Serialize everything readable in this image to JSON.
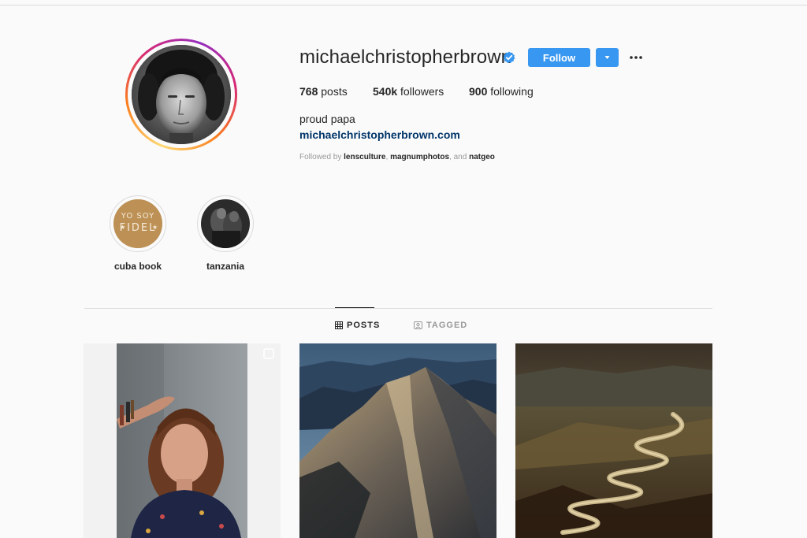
{
  "profile": {
    "username": "michaelchristopherbrown",
    "follow_label": "Follow",
    "stats": {
      "posts_count": "768",
      "posts_label": "posts",
      "followers_count": "540k",
      "followers_label": "followers",
      "following_count": "900",
      "following_label": "following"
    },
    "bio": "proud papa",
    "website": "michaelchristopherbrown.com",
    "followed_by": {
      "prefix": "Followed by",
      "names": [
        "lensculture",
        "magnumphotos",
        "natgeo"
      ],
      "separator": ", ",
      "conjunction": ", and "
    }
  },
  "highlights": [
    {
      "label": "cuba book",
      "cover_text": "YO SOY FIDEL"
    },
    {
      "label": "tanzania"
    }
  ],
  "tabs": [
    {
      "label": "POSTS",
      "icon": "grid-icon",
      "active": true
    },
    {
      "label": "TAGGED",
      "icon": "tag-icon",
      "active": false
    }
  ],
  "posts": [
    {
      "subject": "portrait-woman",
      "type_icon": "carousel-icon"
    },
    {
      "subject": "mountain-ridge"
    },
    {
      "subject": "winding-river"
    }
  ],
  "colors": {
    "accent_blue": "#3897f0",
    "link_navy": "#003569",
    "text_dark": "#262626",
    "text_muted": "#999999",
    "verified_blue": "#3897f0"
  }
}
